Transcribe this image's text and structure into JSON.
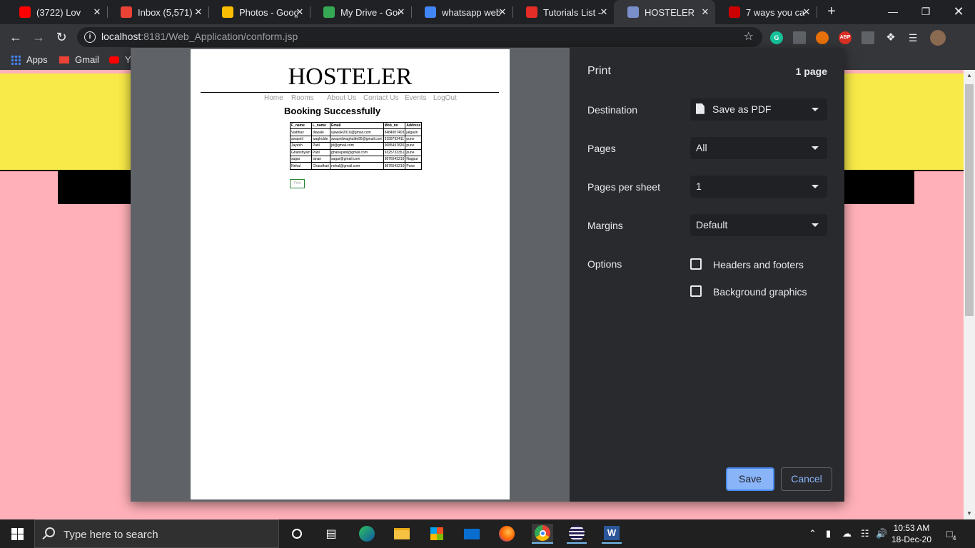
{
  "browser": {
    "tabs": [
      {
        "title": "(3722) Lov",
        "icon": "youtube-icon",
        "color": "#ff0000"
      },
      {
        "title": "Inbox (5,571) -",
        "icon": "gmail-icon",
        "color": "#ea4335"
      },
      {
        "title": "Photos - Goog",
        "icon": "photos-icon",
        "color": "#fbbc04"
      },
      {
        "title": "My Drive - Goo",
        "icon": "drive-icon",
        "color": "#34a853"
      },
      {
        "title": "whatsapp web",
        "icon": "google-icon",
        "color": "#4285f4"
      },
      {
        "title": "Tutorials List -",
        "icon": "tutorials-icon",
        "color": "#e52d27"
      },
      {
        "title": "HOSTELER",
        "icon": "hosteler-icon",
        "color": "#7a8fc9"
      },
      {
        "title": "7 ways you ca",
        "icon": "cnbc-icon",
        "color": "#cc0000"
      }
    ],
    "url_host": "localhost",
    "url_path": ":8181/Web_Application/conform.jsp",
    "ext_abp": "ABP",
    "bookmarks": {
      "apps": "Apps",
      "gmail": "Gmail",
      "youtube": "Y"
    }
  },
  "preview": {
    "logo": "HOSTELER",
    "menu": [
      "Home",
      "Rooms",
      "About Us",
      "Contact Us",
      "Events",
      "LogOut"
    ],
    "heading": "Booking Successfully",
    "table_headers": [
      "F_name",
      "L_name",
      "Email",
      "Mob_no",
      "Address"
    ],
    "table_rows": [
      [
        "Vaibhav",
        "dawale",
        "vjawale2016@gmail.com",
        "8484907403",
        "jalgaon"
      ],
      [
        "swapnil",
        "waghulde",
        "swapnilwaghulde95@gmail.com",
        "9158792411",
        "pune"
      ],
      [
        "Jayesh",
        "Patil",
        "jd@gmail.com",
        "9685457826",
        "pune"
      ],
      [
        "Ghanshyam",
        "Patil",
        "ghanapatil@gmail.com",
        "9325733351",
        "pune"
      ],
      [
        "sagar",
        "lanan",
        "sagar@gmail.com",
        "9876543210",
        "Nagpur"
      ],
      [
        "Nehal",
        "Chaudhari",
        "nehal@gmail.com",
        "9876543210",
        "Pune"
      ]
    ],
    "print_button": "Print"
  },
  "print": {
    "title": "Print",
    "page_count": "1 page",
    "destination_label": "Destination",
    "destination_value": "Save as PDF",
    "pages_label": "Pages",
    "pages_value": "All",
    "pps_label": "Pages per sheet",
    "pps_value": "1",
    "margins_label": "Margins",
    "margins_value": "Default",
    "options_label": "Options",
    "opt_headers": "Headers and footers",
    "opt_background": "Background graphics",
    "save": "Save",
    "cancel": "Cancel"
  },
  "taskbar": {
    "search_placeholder": "Type here to search",
    "time": "10:53 AM",
    "date": "18-Dec-20",
    "notif": "4"
  }
}
